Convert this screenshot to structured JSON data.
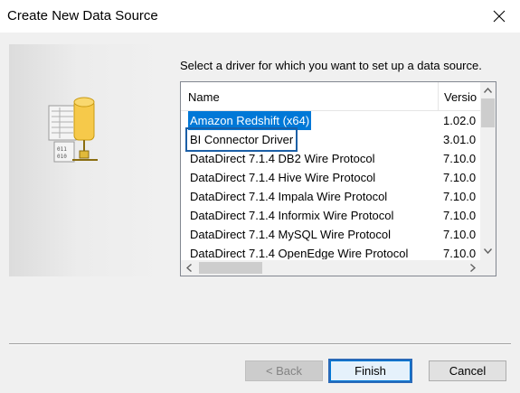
{
  "window": {
    "title": "Create New Data Source",
    "close_icon": "close-icon"
  },
  "prompt": "Select a driver for which you want to set up a data source.",
  "graphic": {
    "icon": "database-icon"
  },
  "driver_list": {
    "columns": {
      "name": "Name",
      "version": "Versio"
    },
    "rows": [
      {
        "name": "Amazon Redshift (x64)",
        "version": "1.02.0",
        "state": "selected"
      },
      {
        "name": "BI Connector Driver",
        "version": "3.01.0",
        "state": "focused"
      },
      {
        "name": "DataDirect 7.1.4 DB2 Wire Protocol",
        "version": "7.10.0"
      },
      {
        "name": "DataDirect 7.1.4 Hive Wire Protocol",
        "version": "7.10.0"
      },
      {
        "name": "DataDirect 7.1.4 Impala Wire Protocol",
        "version": "7.10.0"
      },
      {
        "name": "DataDirect 7.1.4 Informix Wire Protocol",
        "version": "7.10.0"
      },
      {
        "name": "DataDirect 7.1.4 MySQL Wire Protocol",
        "version": "7.10.0"
      },
      {
        "name": "DataDirect 7.1.4 OpenEdge Wire Protocol",
        "version": "7.10.0"
      }
    ]
  },
  "buttons": {
    "back": "< Back",
    "finish": "Finish",
    "cancel": "Cancel"
  },
  "colors": {
    "selection": "#0078d7",
    "focus_outline": "#1b5fa6",
    "dialog_bg": "#f0f0f0"
  }
}
